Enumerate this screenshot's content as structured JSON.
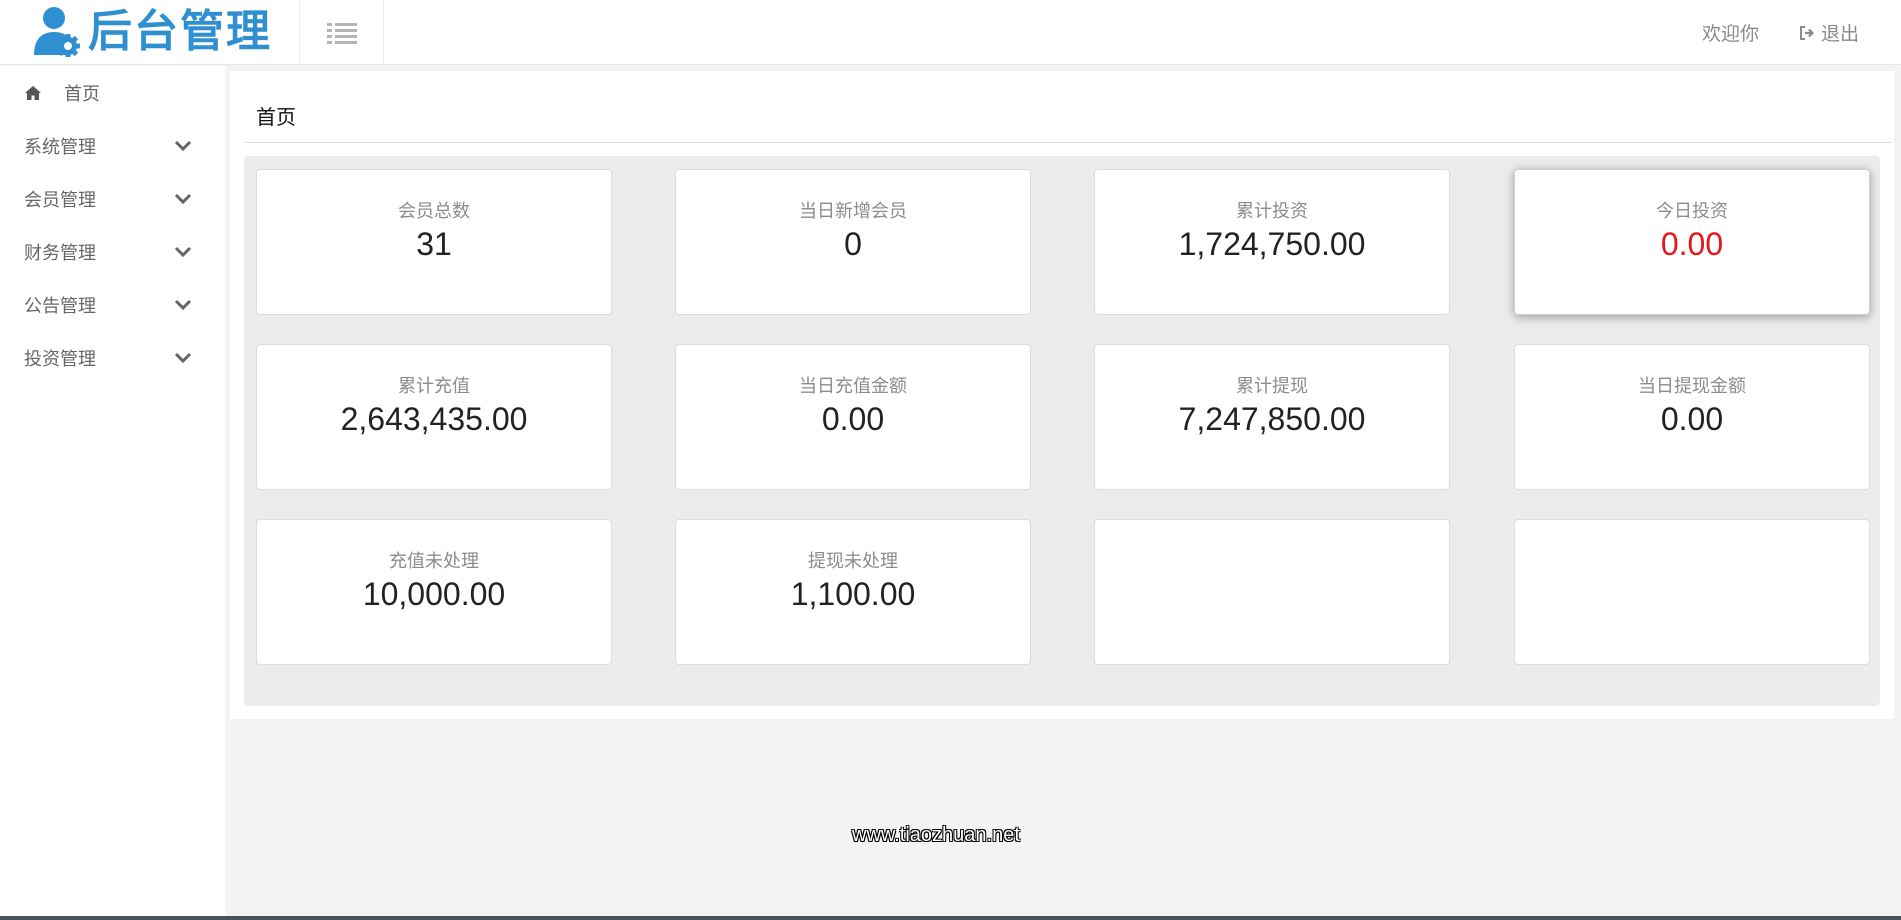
{
  "header": {
    "logo_text": "后台管理",
    "welcome": "欢迎你",
    "logout": "退出"
  },
  "sidebar": {
    "items": [
      {
        "label": "首页",
        "icon": "home-icon"
      },
      {
        "label": "系统管理",
        "icon": "chevron-down-icon"
      },
      {
        "label": "会员管理",
        "icon": "chevron-down-icon"
      },
      {
        "label": "财务管理",
        "icon": "chevron-down-icon"
      },
      {
        "label": "公告管理",
        "icon": "chevron-down-icon"
      },
      {
        "label": "投资管理",
        "icon": "chevron-down-icon"
      }
    ]
  },
  "main": {
    "title": "首页",
    "cards": [
      {
        "label": "会员总数",
        "value": "31"
      },
      {
        "label": "当日新增会员",
        "value": "0"
      },
      {
        "label": "累计投资",
        "value": "1,724,750.00"
      },
      {
        "label": "今日投资",
        "value": "0.00"
      },
      {
        "label": "累计充值",
        "value": "2,643,435.00"
      },
      {
        "label": "当日充值金额",
        "value": "0.00"
      },
      {
        "label": "累计提现",
        "value": "7,247,850.00"
      },
      {
        "label": "当日提现金额",
        "value": "0.00"
      },
      {
        "label": "充值未处理",
        "value": "10,000.00"
      },
      {
        "label": "提现未处理",
        "value": "1,100.00"
      },
      {
        "label": "",
        "value": ""
      },
      {
        "label": "",
        "value": ""
      }
    ]
  },
  "watermark": "www.tiaozhuan.net",
  "colors": {
    "brand": "#2f8fd0",
    "alert_value": "#e8141b",
    "panel_bg": "#ececec"
  }
}
